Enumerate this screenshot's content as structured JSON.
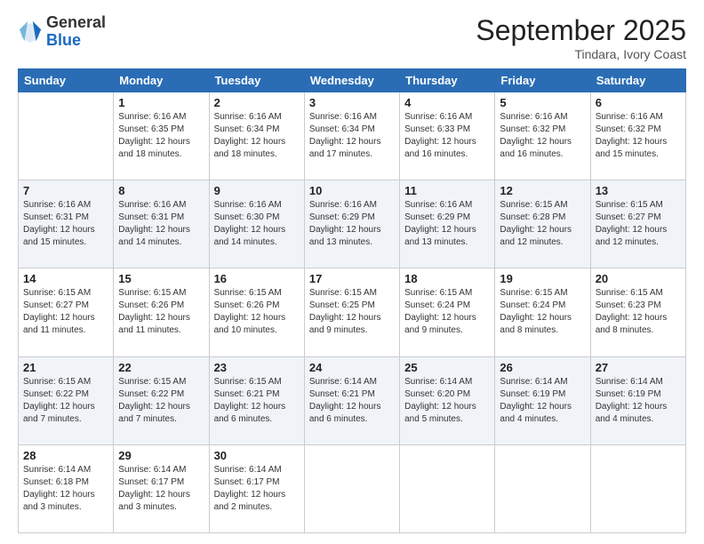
{
  "logo": {
    "general": "General",
    "blue": "Blue"
  },
  "header": {
    "month": "September 2025",
    "location": "Tindara, Ivory Coast"
  },
  "days_of_week": [
    "Sunday",
    "Monday",
    "Tuesday",
    "Wednesday",
    "Thursday",
    "Friday",
    "Saturday"
  ],
  "weeks": [
    [
      {
        "day": "",
        "sunrise": "",
        "sunset": "",
        "daylight": ""
      },
      {
        "day": "1",
        "sunrise": "Sunrise: 6:16 AM",
        "sunset": "Sunset: 6:35 PM",
        "daylight": "Daylight: 12 hours and 18 minutes."
      },
      {
        "day": "2",
        "sunrise": "Sunrise: 6:16 AM",
        "sunset": "Sunset: 6:34 PM",
        "daylight": "Daylight: 12 hours and 18 minutes."
      },
      {
        "day": "3",
        "sunrise": "Sunrise: 6:16 AM",
        "sunset": "Sunset: 6:34 PM",
        "daylight": "Daylight: 12 hours and 17 minutes."
      },
      {
        "day": "4",
        "sunrise": "Sunrise: 6:16 AM",
        "sunset": "Sunset: 6:33 PM",
        "daylight": "Daylight: 12 hours and 16 minutes."
      },
      {
        "day": "5",
        "sunrise": "Sunrise: 6:16 AM",
        "sunset": "Sunset: 6:32 PM",
        "daylight": "Daylight: 12 hours and 16 minutes."
      },
      {
        "day": "6",
        "sunrise": "Sunrise: 6:16 AM",
        "sunset": "Sunset: 6:32 PM",
        "daylight": "Daylight: 12 hours and 15 minutes."
      }
    ],
    [
      {
        "day": "7",
        "sunrise": "Sunrise: 6:16 AM",
        "sunset": "Sunset: 6:31 PM",
        "daylight": "Daylight: 12 hours and 15 minutes."
      },
      {
        "day": "8",
        "sunrise": "Sunrise: 6:16 AM",
        "sunset": "Sunset: 6:31 PM",
        "daylight": "Daylight: 12 hours and 14 minutes."
      },
      {
        "day": "9",
        "sunrise": "Sunrise: 6:16 AM",
        "sunset": "Sunset: 6:30 PM",
        "daylight": "Daylight: 12 hours and 14 minutes."
      },
      {
        "day": "10",
        "sunrise": "Sunrise: 6:16 AM",
        "sunset": "Sunset: 6:29 PM",
        "daylight": "Daylight: 12 hours and 13 minutes."
      },
      {
        "day": "11",
        "sunrise": "Sunrise: 6:16 AM",
        "sunset": "Sunset: 6:29 PM",
        "daylight": "Daylight: 12 hours and 13 minutes."
      },
      {
        "day": "12",
        "sunrise": "Sunrise: 6:15 AM",
        "sunset": "Sunset: 6:28 PM",
        "daylight": "Daylight: 12 hours and 12 minutes."
      },
      {
        "day": "13",
        "sunrise": "Sunrise: 6:15 AM",
        "sunset": "Sunset: 6:27 PM",
        "daylight": "Daylight: 12 hours and 12 minutes."
      }
    ],
    [
      {
        "day": "14",
        "sunrise": "Sunrise: 6:15 AM",
        "sunset": "Sunset: 6:27 PM",
        "daylight": "Daylight: 12 hours and 11 minutes."
      },
      {
        "day": "15",
        "sunrise": "Sunrise: 6:15 AM",
        "sunset": "Sunset: 6:26 PM",
        "daylight": "Daylight: 12 hours and 11 minutes."
      },
      {
        "day": "16",
        "sunrise": "Sunrise: 6:15 AM",
        "sunset": "Sunset: 6:26 PM",
        "daylight": "Daylight: 12 hours and 10 minutes."
      },
      {
        "day": "17",
        "sunrise": "Sunrise: 6:15 AM",
        "sunset": "Sunset: 6:25 PM",
        "daylight": "Daylight: 12 hours and 9 minutes."
      },
      {
        "day": "18",
        "sunrise": "Sunrise: 6:15 AM",
        "sunset": "Sunset: 6:24 PM",
        "daylight": "Daylight: 12 hours and 9 minutes."
      },
      {
        "day": "19",
        "sunrise": "Sunrise: 6:15 AM",
        "sunset": "Sunset: 6:24 PM",
        "daylight": "Daylight: 12 hours and 8 minutes."
      },
      {
        "day": "20",
        "sunrise": "Sunrise: 6:15 AM",
        "sunset": "Sunset: 6:23 PM",
        "daylight": "Daylight: 12 hours and 8 minutes."
      }
    ],
    [
      {
        "day": "21",
        "sunrise": "Sunrise: 6:15 AM",
        "sunset": "Sunset: 6:22 PM",
        "daylight": "Daylight: 12 hours and 7 minutes."
      },
      {
        "day": "22",
        "sunrise": "Sunrise: 6:15 AM",
        "sunset": "Sunset: 6:22 PM",
        "daylight": "Daylight: 12 hours and 7 minutes."
      },
      {
        "day": "23",
        "sunrise": "Sunrise: 6:15 AM",
        "sunset": "Sunset: 6:21 PM",
        "daylight": "Daylight: 12 hours and 6 minutes."
      },
      {
        "day": "24",
        "sunrise": "Sunrise: 6:14 AM",
        "sunset": "Sunset: 6:21 PM",
        "daylight": "Daylight: 12 hours and 6 minutes."
      },
      {
        "day": "25",
        "sunrise": "Sunrise: 6:14 AM",
        "sunset": "Sunset: 6:20 PM",
        "daylight": "Daylight: 12 hours and 5 minutes."
      },
      {
        "day": "26",
        "sunrise": "Sunrise: 6:14 AM",
        "sunset": "Sunset: 6:19 PM",
        "daylight": "Daylight: 12 hours and 4 minutes."
      },
      {
        "day": "27",
        "sunrise": "Sunrise: 6:14 AM",
        "sunset": "Sunset: 6:19 PM",
        "daylight": "Daylight: 12 hours and 4 minutes."
      }
    ],
    [
      {
        "day": "28",
        "sunrise": "Sunrise: 6:14 AM",
        "sunset": "Sunset: 6:18 PM",
        "daylight": "Daylight: 12 hours and 3 minutes."
      },
      {
        "day": "29",
        "sunrise": "Sunrise: 6:14 AM",
        "sunset": "Sunset: 6:17 PM",
        "daylight": "Daylight: 12 hours and 3 minutes."
      },
      {
        "day": "30",
        "sunrise": "Sunrise: 6:14 AM",
        "sunset": "Sunset: 6:17 PM",
        "daylight": "Daylight: 12 hours and 2 minutes."
      },
      {
        "day": "",
        "sunrise": "",
        "sunset": "",
        "daylight": ""
      },
      {
        "day": "",
        "sunrise": "",
        "sunset": "",
        "daylight": ""
      },
      {
        "day": "",
        "sunrise": "",
        "sunset": "",
        "daylight": ""
      },
      {
        "day": "",
        "sunrise": "",
        "sunset": "",
        "daylight": ""
      }
    ]
  ]
}
